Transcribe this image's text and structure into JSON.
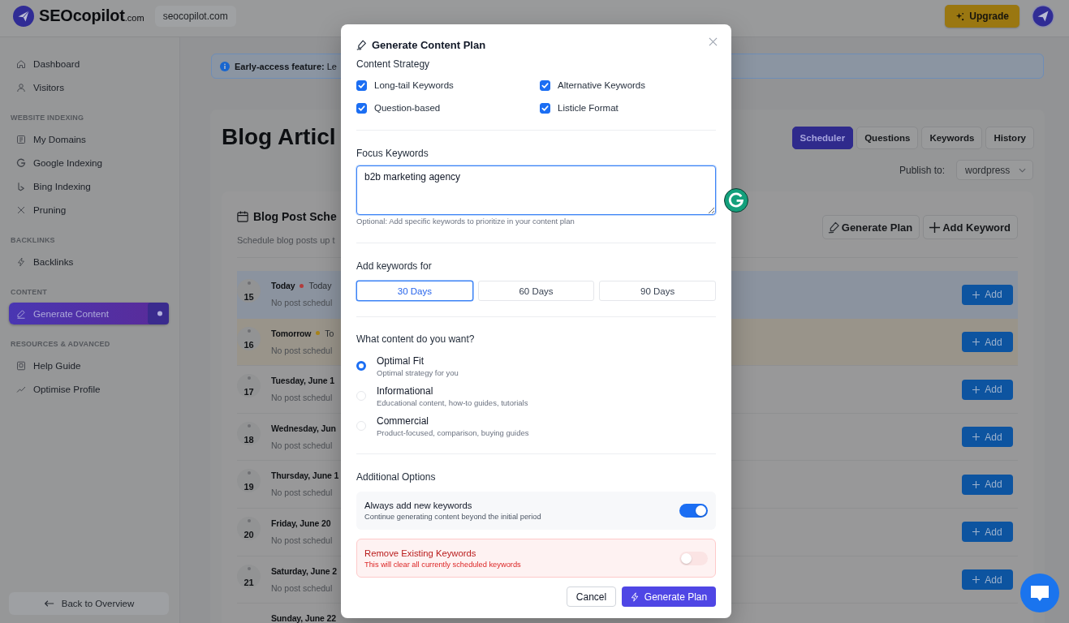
{
  "header": {
    "brand": "SEOcopilot",
    "brand_suffix": ".com",
    "domain": "seocopilot.com",
    "upgrade_button": "Upgrade"
  },
  "sidebar": {
    "sections": [
      {
        "items": [
          {
            "label": "Dashboard",
            "selected": false
          },
          {
            "label": "Visitors",
            "selected": false
          }
        ]
      },
      {
        "heading": "WEBSITE INDEXING",
        "items": [
          {
            "label": "My Domains",
            "selected": false
          },
          {
            "label": "Google Indexing",
            "selected": false
          },
          {
            "label": "Bing Indexing",
            "selected": false
          },
          {
            "label": "Pruning",
            "selected": false
          }
        ]
      },
      {
        "heading": "BACKLINKS",
        "items": [
          {
            "label": "Backlinks",
            "selected": false
          }
        ]
      },
      {
        "heading": "CONTENT",
        "items": [
          {
            "label": "Generate Content",
            "selected": true
          }
        ]
      },
      {
        "heading": "RESOURCES & ADVANCED",
        "items": [
          {
            "label": "Help Guide",
            "selected": false
          },
          {
            "label": "Optimise Profile",
            "selected": false
          }
        ]
      }
    ],
    "back_button": "Back to Overview"
  },
  "banner": {
    "text": "**Early-access feature:** Le"
  },
  "page": {
    "title": "Blog Articl",
    "tabs": [
      {
        "label": "Scheduler",
        "selected": true
      },
      {
        "label": "Questions",
        "selected": false
      },
      {
        "label": "Keywords",
        "selected": false
      },
      {
        "label": "History",
        "selected": false
      }
    ],
    "publish_label": "Publish to:",
    "publish_target": "wordpress"
  },
  "scheduler": {
    "title": "Blog Post Sche",
    "subtitle": "Schedule blog posts up t",
    "generate_button": "Generate Plan",
    "add_keyword_button": "Add Keyword",
    "rows": [
      {
        "kind": "current",
        "day": "15",
        "title": "Today",
        "tag": "Today",
        "color": "#b23c3c",
        "status": "No post schedul",
        "add_button": "Add"
      },
      {
        "kind": "next",
        "day": "16",
        "title": "Tomorrow",
        "tag": "To",
        "color": "#a8831a",
        "status": "No post schedul",
        "add_button": "Add"
      },
      {
        "kind": "upcoming",
        "day": "17",
        "title": "Tuesday, June 1",
        "status": "No post schedul",
        "add_button": "Add"
      },
      {
        "kind": "upcoming",
        "day": "18",
        "title": "Wednesday, Jun",
        "status": "No post schedul",
        "add_button": "Add"
      },
      {
        "kind": "upcoming",
        "day": "19",
        "title": "Thursday, June 1",
        "status": "No post schedul",
        "add_button": "Add"
      },
      {
        "kind": "upcoming",
        "day": "20",
        "title": "Friday, June 20",
        "status": "No post schedul",
        "add_button": "Add"
      },
      {
        "kind": "upcoming",
        "day": "21",
        "title": "Saturday, June 2",
        "status": "No post schedul",
        "add_button": "Add"
      },
      {
        "kind": "upcoming",
        "title": "Sunday, June 22"
      }
    ]
  },
  "dialog": {
    "title": "Generate Content Plan",
    "strategy": {
      "label": "Content Strategy",
      "options": [
        {
          "label": "Long-tail Keywords",
          "checked": true
        },
        {
          "label": "Alternative Keywords",
          "checked": true
        },
        {
          "label": "Question-based",
          "checked": true
        },
        {
          "label": "Listicle Format",
          "checked": true
        }
      ]
    },
    "focus_keywords": {
      "label": "Focus Keywords",
      "value": "b2b marketing agency",
      "hint": "Optional: Add specific keywords to prioritize in your content plan"
    },
    "period": {
      "label": "Add keywords for",
      "options": [
        {
          "label": "30 Days",
          "selected": true
        },
        {
          "label": "60 Days",
          "selected": false
        },
        {
          "label": "90 Days",
          "selected": false
        }
      ]
    },
    "content_type": {
      "label": "What content do you want?",
      "options": [
        {
          "label": "Optimal Fit",
          "description": "Optimal strategy for you",
          "selected": true
        },
        {
          "label": "Informational",
          "description": "Educational content, how-to guides, tutorials",
          "selected": false
        },
        {
          "label": "Commercial",
          "description": "Product-focused, comparison, buying guides",
          "selected": false
        }
      ]
    },
    "additional": {
      "label": "Additional Options",
      "options": [
        {
          "kind": "normal",
          "title": "Always add new keywords",
          "description": "Continue generating content beyond the initial period",
          "on": true
        },
        {
          "kind": "danger",
          "title": "Remove Existing Keywords",
          "description": "This will clear all currently scheduled keywords",
          "on": false
        }
      ]
    },
    "cancel_button": "Cancel",
    "submit_button": "Generate Plan"
  }
}
